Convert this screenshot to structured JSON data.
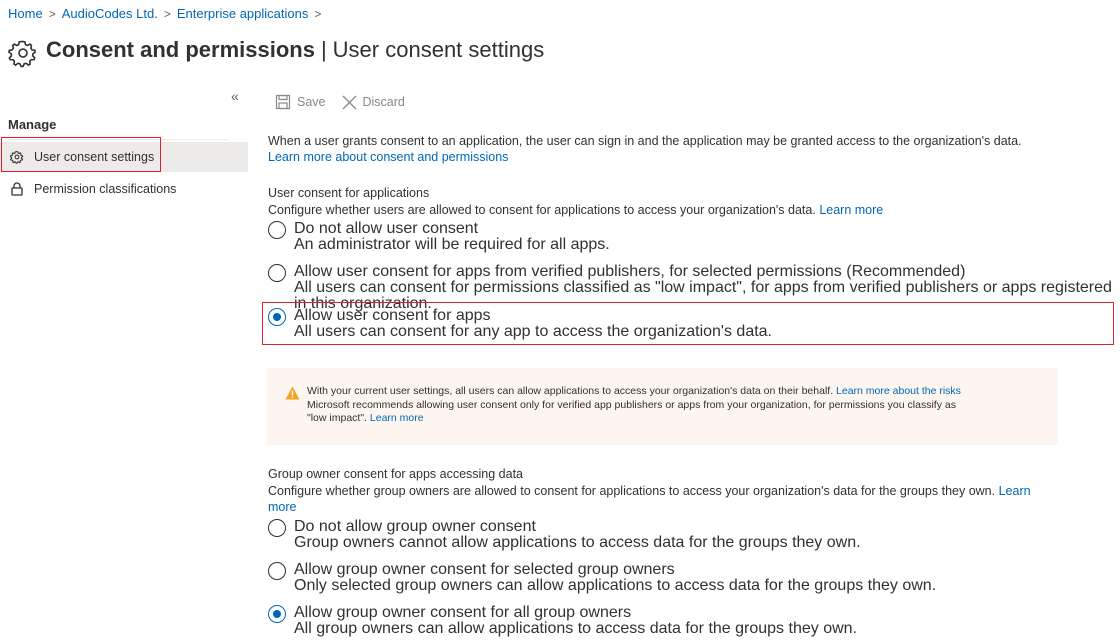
{
  "breadcrumb": {
    "items": [
      "Home",
      "AudioCodes Ltd.",
      "Enterprise applications"
    ],
    "separator": ">"
  },
  "title": {
    "bold": "Consent and permissions",
    "separator": "|",
    "light": "User consent settings",
    "icon": "gear-icon"
  },
  "sidebar": {
    "collapse_glyph": "«",
    "section_label": "Manage",
    "items": [
      {
        "label": "User consent settings",
        "icon": "gear-icon",
        "active": true
      },
      {
        "label": "Permission classifications",
        "icon": "lock-icon",
        "active": false
      }
    ]
  },
  "toolbar": {
    "save_label": "Save",
    "discard_label": "Discard"
  },
  "intro": {
    "text": "When a user grants consent to an application, the user can sign in and the application may be granted access to the organization's data.",
    "link": "Learn more about consent and permissions"
  },
  "user_consent": {
    "heading": "User consent for applications",
    "description": "Configure whether users are allowed to consent for applications to access your organization's data.",
    "link": "Learn more",
    "options": [
      {
        "label": "Do not allow user consent",
        "desc": "An administrator will be required for all apps.",
        "checked": false
      },
      {
        "label": "Allow user consent for apps from verified publishers, for selected permissions (Recommended)",
        "desc": "All users can consent for permissions classified as \"low impact\", for apps from verified publishers or apps registered in this organization.",
        "checked": false
      },
      {
        "label": "Allow user consent for apps",
        "desc": "All users can consent for any app to access the organization's data.",
        "checked": true
      }
    ]
  },
  "warning": {
    "icon": "warning-icon",
    "line1": "With your current user settings, all users can allow applications to access your organization's data on their behalf.",
    "line1_link": "Learn more about the risks",
    "line2": "Microsoft recommends allowing user consent only for verified app publishers or apps from your organization, for permissions you classify as",
    "line3": "\"low impact\".",
    "line3_link": "Learn more"
  },
  "group_consent": {
    "heading": "Group owner consent for apps accessing data",
    "description": "Configure whether group owners are allowed to consent for applications to access your organization's data for the groups they own.",
    "link_part1": "Learn",
    "link_part2": "more",
    "options": [
      {
        "label": "Do not allow group owner consent",
        "desc": "Group owners cannot allow applications to access data for the groups they own.",
        "checked": false
      },
      {
        "label": "Allow group owner consent for selected group owners",
        "desc": "Only selected group owners can allow applications to access data for the groups they own.",
        "checked": false
      },
      {
        "label": "Allow group owner consent for all group owners",
        "desc": "All group owners can allow applications to access data for the groups they own.",
        "checked": true
      }
    ]
  },
  "colors": {
    "link": "#0067b8",
    "highlight_border": "#e0202a",
    "warning_bg": "#fdf6f0",
    "warning_icon": "#f2a31b"
  }
}
